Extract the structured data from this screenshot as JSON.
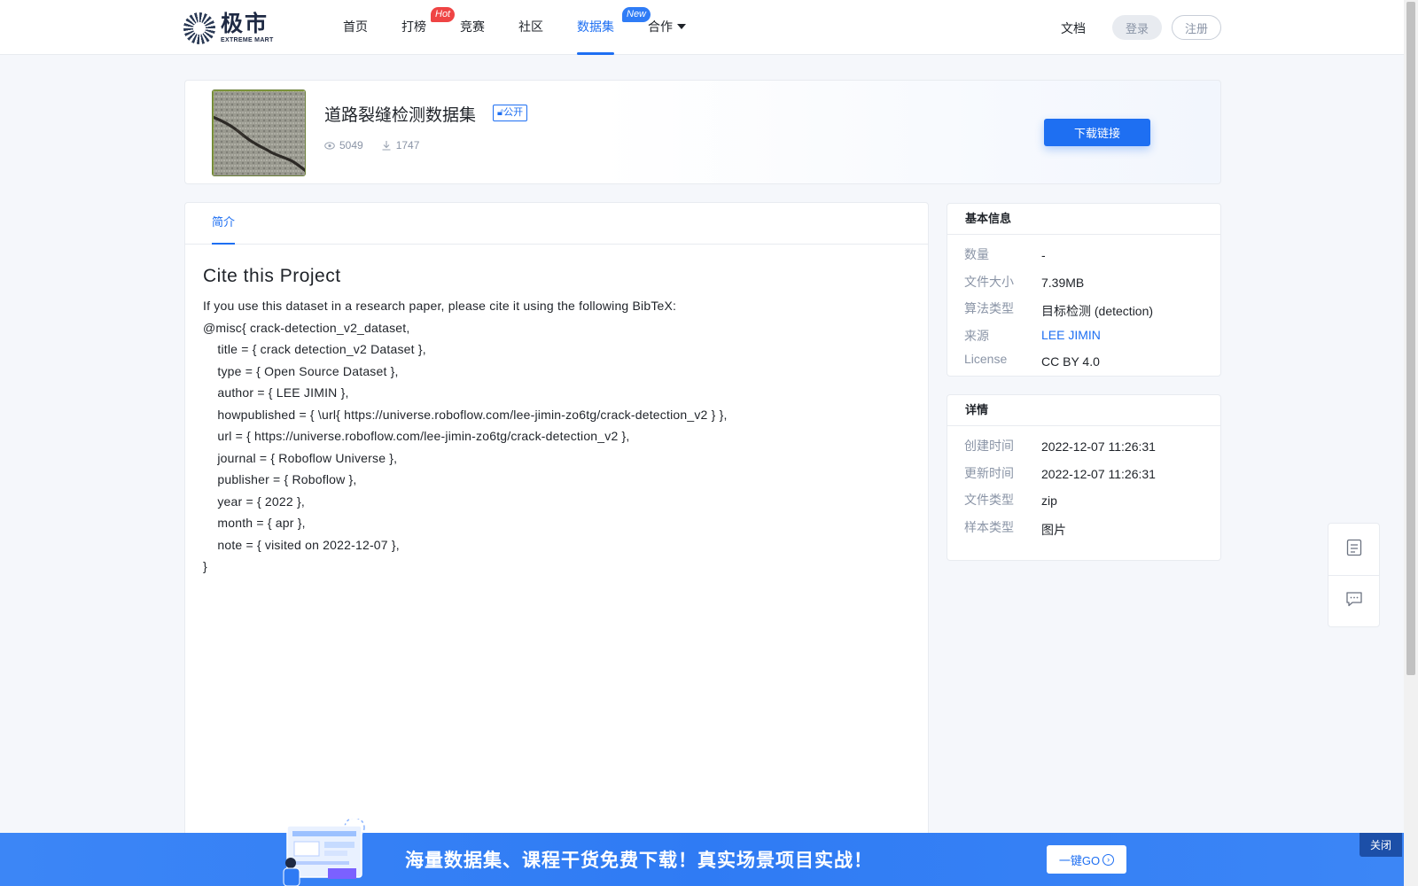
{
  "header": {
    "logo_cn": "极市",
    "logo_en": "EXTREME MART",
    "nav": [
      {
        "label": "首页"
      },
      {
        "label": "打榜",
        "badge": "Hot"
      },
      {
        "label": "竞赛"
      },
      {
        "label": "社区"
      },
      {
        "label": "数据集",
        "badge": "New",
        "active": true
      },
      {
        "label": "合作"
      }
    ],
    "docs": "文档",
    "login": "登录",
    "register": "注册"
  },
  "dataset": {
    "title": "道路裂缝检测数据集",
    "visibility": "公开",
    "views": "5049",
    "downloads": "1747",
    "download_button": "下载链接"
  },
  "tabs": {
    "intro": "简介"
  },
  "content": {
    "heading": "Cite this Project",
    "body": "If you use this dataset in a research paper, please cite it using the following BibTeX:\n@misc{ crack-detection_v2_dataset,\n    title = { crack detection_v2 Dataset },\n    type = { Open Source Dataset },\n    author = { LEE JIMIN },\n    howpublished = { \\url{ https://universe.roboflow.com/lee-jimin-zo6tg/crack-detection_v2 } },\n    url = { https://universe.roboflow.com/lee-jimin-zo6tg/crack-detection_v2 },\n    journal = { Roboflow Universe },\n    publisher = { Roboflow },\n    year = { 2022 },\n    month = { apr },\n    note = { visited on 2022-12-07 },\n}"
  },
  "basic_info": {
    "title": "基本信息",
    "rows": [
      {
        "key": "数量",
        "value": "-"
      },
      {
        "key": "文件大小",
        "value": "7.39MB"
      },
      {
        "key": "算法类型",
        "value": "目标检测 (detection)"
      },
      {
        "key": "来源",
        "value": "LEE JIMIN"
      },
      {
        "key": "License",
        "value": "CC BY 4.0"
      }
    ]
  },
  "details": {
    "title": "详情",
    "rows": [
      {
        "key": "创建时间",
        "value": "2022-12-07 11:26:31"
      },
      {
        "key": "更新时间",
        "value": "2022-12-07 11:26:31"
      },
      {
        "key": "文件类型",
        "value": "zip"
      },
      {
        "key": "样本类型",
        "value": "图片"
      }
    ]
  },
  "promo": {
    "text": "海量数据集、课程干货免费下载！真实场景项目实战！",
    "go_button": "一键GO",
    "close": "关闭"
  },
  "colors": {
    "accent": "#1e6ff2",
    "hot_badge": "#ef4444",
    "promo_bg": "#3c86f6"
  },
  "icons": {
    "views": "eye-icon",
    "downloads": "download-icon",
    "doc_tool": "document-icon",
    "chat_tool": "chat-icon"
  }
}
